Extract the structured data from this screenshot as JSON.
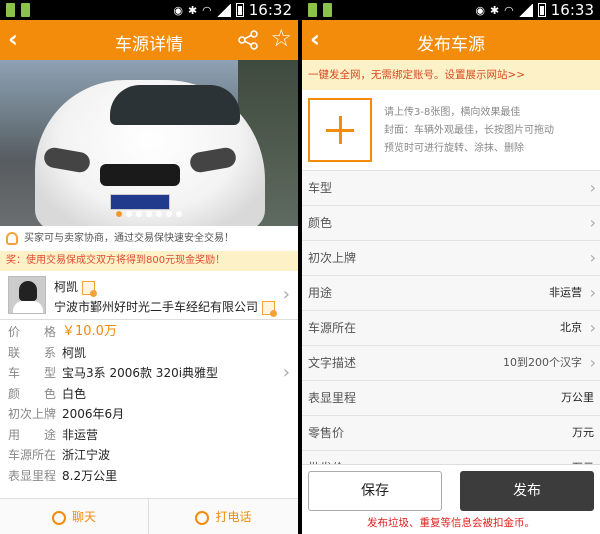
{
  "left": {
    "status": {
      "time": "16:32"
    },
    "header": {
      "back_icon": "back-arrow-icon",
      "title": "车源详情",
      "share_icon": "share-icon",
      "favorite_icon": "star-icon"
    },
    "photo": {
      "alt": "white-bmw-photo",
      "page_count": 7,
      "current_page": 1
    },
    "tips": {
      "safe_trade": "买家可与卖家协商，通过交易保快速安全交易！",
      "reward": "奖：使用交易保成交双方将得到800元现金奖励！"
    },
    "seller": {
      "name": "柯凯",
      "company": "宁波市鄞州好时光二手车经纪有限公司"
    },
    "info": [
      {
        "label": "价格",
        "value": "￥10.0万"
      },
      {
        "label": "联系",
        "value": "柯凯"
      },
      {
        "label": "车型",
        "value": "宝马3系 2006款 320i典雅型"
      },
      {
        "label": "颜色",
        "value": "白色"
      },
      {
        "label": "初次上牌",
        "value": "2006年6月"
      },
      {
        "label": "用途",
        "value": "非运营"
      },
      {
        "label": "车源所在",
        "value": "浙江宁波"
      },
      {
        "label": "表显里程",
        "value": "8.2万公里"
      }
    ],
    "actions": {
      "chat": "聊天",
      "call": "打电话"
    }
  },
  "right": {
    "status": {
      "time": "16:33"
    },
    "header": {
      "back_icon": "back-arrow-icon",
      "title": "发布车源"
    },
    "banner": "一键发全网，无需绑定账号。设置展示网站>>",
    "upload": {
      "line1": "请上传3-8张图，横向效果最佳",
      "line2": "封面：车辆外观最佳，长按图片可拖动",
      "line3": "预览时可进行旋转、涂抹、删除"
    },
    "fields": [
      {
        "label": "车型",
        "value": "",
        "chevron": true
      },
      {
        "label": "颜色",
        "value": "",
        "chevron": true
      },
      {
        "label": "初次上牌",
        "value": "",
        "chevron": true
      },
      {
        "label": "用途",
        "value": "非运营",
        "chevron": true
      },
      {
        "label": "车源所在",
        "value": "北京",
        "chevron": true
      },
      {
        "label": "文字描述",
        "value": "10到200个汉字",
        "chevron": true
      },
      {
        "label": "表显里程",
        "value": "万公里",
        "chevron": false
      },
      {
        "label": "零售价",
        "value": "万元",
        "chevron": false
      },
      {
        "label": "批发价",
        "value": "万元",
        "chevron": false
      }
    ],
    "footer": {
      "save": "保存",
      "publish": "发布",
      "warning": "发布垃圾、重复等信息会被扣金币。"
    }
  },
  "colors": {
    "accent": "#f38b0b",
    "warning": "#e0201f",
    "banner_bg": "#fdf1c8",
    "publish_bg": "#3c3c3c"
  }
}
